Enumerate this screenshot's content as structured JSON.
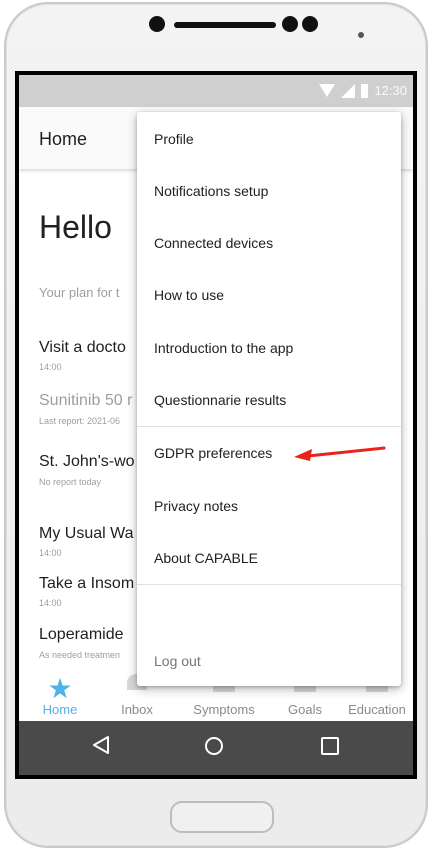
{
  "statusbar": {
    "time": "12:30"
  },
  "appbar": {
    "title": "Home"
  },
  "main": {
    "greeting": "Hello",
    "plan_label": "Your plan for t",
    "items": [
      {
        "title": "Visit a docto",
        "sub": "14:00",
        "dim": false
      },
      {
        "title": "Sunitinib 50 r",
        "sub": "Last report: 2021-06",
        "dim": true
      },
      {
        "title": "St. John's-wo",
        "sub": "No report today",
        "dim": false
      },
      {
        "title": "My Usual Wa",
        "sub": "14:00",
        "dim": false
      },
      {
        "title": "Take a Insom",
        "sub": "14:00",
        "dim": false
      },
      {
        "title": "Loperamide",
        "sub": "As needed treatmen",
        "dim": false
      }
    ]
  },
  "bottom_nav": {
    "items": [
      {
        "label": "Home",
        "icon": "star-icon",
        "active": true
      },
      {
        "label": "Inbox",
        "icon": "inbox-icon",
        "active": false
      },
      {
        "label": "Symptoms",
        "icon": "symptoms-icon",
        "active": false
      },
      {
        "label": "Goals",
        "icon": "goals-icon",
        "active": false
      },
      {
        "label": "Education",
        "icon": "education-icon",
        "active": false
      }
    ],
    "active_color": "#4fb3e8"
  },
  "menu": {
    "items": [
      "Profile",
      "Notifications setup",
      "Connected devices",
      "How to use",
      "Introduction to the app",
      "Questionnarie results",
      "GDPR preferences",
      "Privacy notes",
      "About CAPABLE",
      "Log out"
    ]
  },
  "annotation": {
    "arrow_color": "#e8231c",
    "target": "GDPR preferences"
  }
}
